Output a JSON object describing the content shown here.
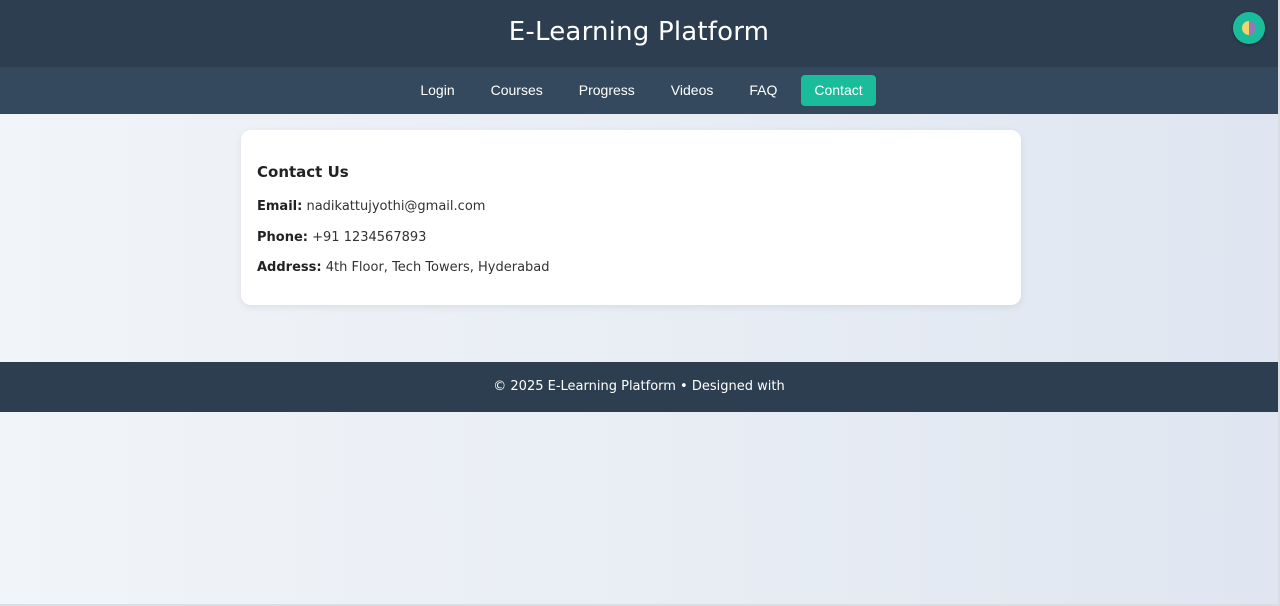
{
  "header": {
    "title": "E-Learning Platform",
    "theme_toggle_icon": "half-circle-icon"
  },
  "nav": {
    "items": [
      {
        "label": "Login"
      },
      {
        "label": "Courses"
      },
      {
        "label": "Progress"
      },
      {
        "label": "Videos"
      },
      {
        "label": "FAQ"
      },
      {
        "label": "Contact",
        "active": true
      }
    ]
  },
  "contact": {
    "heading": "Contact Us",
    "email_label": "Email:",
    "email_value": "nadikattujyothi@gmail.com",
    "phone_label": "Phone:",
    "phone_value": "+91 1234567893",
    "address_label": "Address:",
    "address_value": "4th Floor, Tech Towers, Hyderabad"
  },
  "footer": {
    "text": "© 2025 E-Learning Platform • Designed with"
  },
  "colors": {
    "header_bg": "#2c3e50",
    "nav_bg": "#34495e",
    "accent": "#1abc9c",
    "card_bg": "#ffffff"
  }
}
